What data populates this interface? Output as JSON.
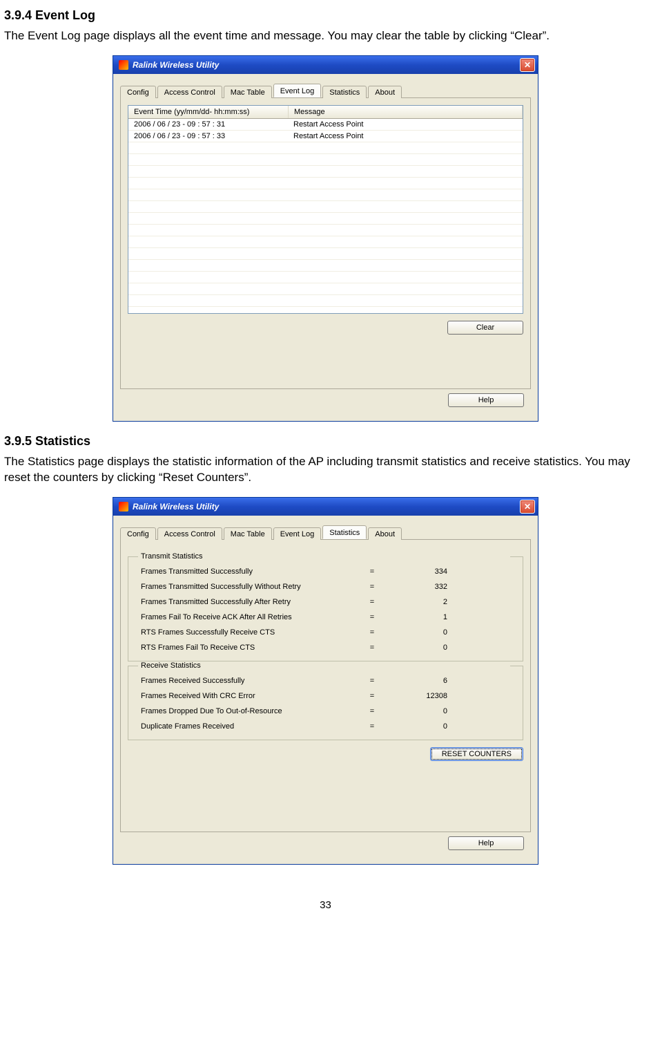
{
  "section1": {
    "heading": "3.9.4  Event Log",
    "para": "The Event Log page displays all the event time and message. You may clear the table by clicking “Clear”."
  },
  "section2": {
    "heading": "3.9.5  Statistics",
    "para": "The Statistics page displays the statistic information of the AP including transmit statistics and receive statistics. You may reset the counters by clicking “Reset Counters”."
  },
  "app_title": "Ralink Wireless Utility",
  "tabs": {
    "config": "Config",
    "access_control": "Access Control",
    "mac_table": "Mac Table",
    "event_log": "Event Log",
    "statistics": "Statistics",
    "about": "About"
  },
  "eventlog": {
    "col_time": "Event Time (yy/mm/dd- hh:mm:ss)",
    "col_msg": "Message",
    "rows": [
      {
        "time": "2006 / 06 / 23 - 09 : 57 : 31",
        "msg": "Restart Access Point"
      },
      {
        "time": "2006 / 06 / 23 - 09 : 57 : 33",
        "msg": "Restart Access Point"
      }
    ],
    "clear_label": "Clear",
    "help_label": "Help"
  },
  "stats": {
    "tx_legend": "Transmit Statistics",
    "rx_legend": "Receive Statistics",
    "tx": [
      {
        "label": "Frames Transmitted Successfully",
        "value": "334"
      },
      {
        "label": "Frames Transmitted Successfully  Without Retry",
        "value": "332"
      },
      {
        "label": "Frames Transmitted Successfully After Retry",
        "value": "2"
      },
      {
        "label": "Frames Fail To Receive ACK After All Retries",
        "value": "1"
      },
      {
        "label": "RTS Frames Successfully Receive CTS",
        "value": "0"
      },
      {
        "label": "RTS Frames Fail To Receive CTS",
        "value": "0"
      }
    ],
    "rx": [
      {
        "label": "Frames Received Successfully",
        "value": "6"
      },
      {
        "label": "Frames Received With CRC Error",
        "value": "12308"
      },
      {
        "label": "Frames Dropped Due To Out-of-Resource",
        "value": "0"
      },
      {
        "label": "Duplicate Frames Received",
        "value": "0"
      }
    ],
    "reset_label": "RESET COUNTERS",
    "help_label": "Help"
  },
  "page_number": "33"
}
